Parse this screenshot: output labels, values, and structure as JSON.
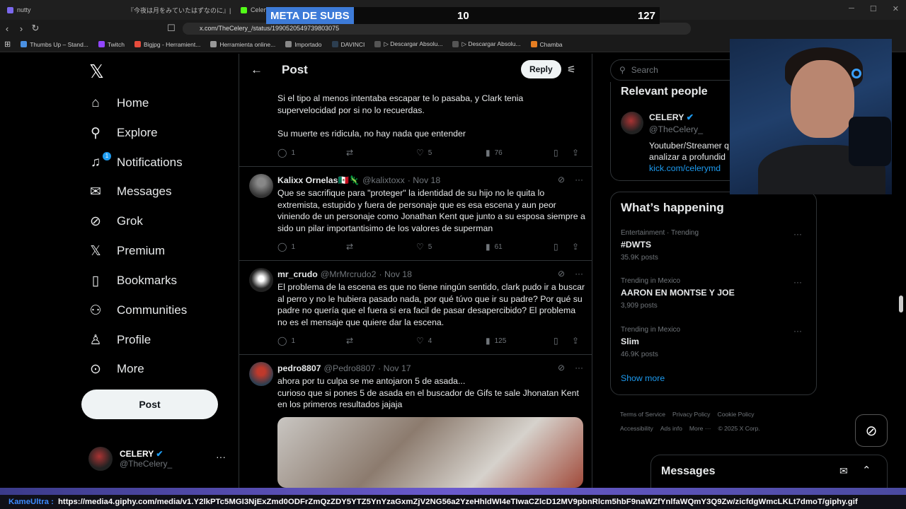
{
  "browser": {
    "tabs": [
      {
        "label": "nutty",
        "color": "#7b68ee"
      },
      {
        "label": "『今夜は月をみていたはずなのに』| 日本",
        "color": "#ff0033"
      },
      {
        "label": "Celery",
        "color": "#53fc18"
      },
      {
        "label": "",
        "color": "#333333"
      }
    ],
    "url": "x.com/TheCelery_/status/1990520549739803075",
    "bookmarks": [
      {
        "label": "Thumbs Up – Stand...",
        "color": "#4a90e2"
      },
      {
        "label": "Twitch",
        "color": "#9146ff"
      },
      {
        "label": "Bigjpg - Herramient...",
        "color": "#e74c3c"
      },
      {
        "label": "Herramienta online...",
        "color": "#999999"
      },
      {
        "label": "Importado",
        "color": "#888888"
      },
      {
        "label": "DAVINCI",
        "color": "#2c3e50"
      },
      {
        "label": "▷ Descargar Absolu...",
        "color": "#555555"
      },
      {
        "label": "▷ Descargar Absolu...",
        "color": "#555555"
      },
      {
        "label": "Chamba",
        "color": "#e67e22"
      }
    ]
  },
  "overlay": {
    "subs_label": "META DE SUBS",
    "subs_current": "10",
    "subs_goal": "127"
  },
  "nav": {
    "items": [
      {
        "label": "Home",
        "icon": "home-icon",
        "glyph": "⌂"
      },
      {
        "label": "Explore",
        "icon": "search-icon",
        "glyph": "⚲"
      },
      {
        "label": "Notifications",
        "icon": "bell-icon",
        "glyph": "🔔",
        "badge": "1"
      },
      {
        "label": "Messages",
        "icon": "envelope-icon",
        "glyph": "✉"
      },
      {
        "label": "Grok",
        "icon": "grok-icon",
        "glyph": "⊘"
      },
      {
        "label": "Premium",
        "icon": "x-premium-icon",
        "glyph": "𝕏"
      },
      {
        "label": "Bookmarks",
        "icon": "bookmark-icon",
        "glyph": "🔖"
      },
      {
        "label": "Communities",
        "icon": "people-icon",
        "glyph": "👥"
      },
      {
        "label": "Profile",
        "icon": "person-icon",
        "glyph": "👤"
      },
      {
        "label": "More",
        "icon": "more-circle-icon",
        "glyph": "⋯"
      }
    ],
    "post_label": "Post",
    "account": {
      "name": "CELERY",
      "handle": "@TheCelery_"
    }
  },
  "main": {
    "title": "Post",
    "reply_label": "Reply",
    "partial_post": {
      "text_lines": [
        "Si el tipo al menos intentaba escapar te lo pasaba, y Clark tenia",
        "supervelocidad por si no lo recuerdas.",
        "",
        "Su muerte es ridicula, no hay nada que entender"
      ],
      "replies": "1",
      "reposts": "",
      "likes": "5",
      "views": "76"
    },
    "tweets": [
      {
        "name": "Kalixx Ornelas🇲🇽🦎",
        "handle": "@kalixtoxx",
        "date": "· Nov 18",
        "text": "Que se sacrifique para \"proteger\" la identidad de su hijo no le quita lo extremista, estupido y fuera de personaje que es esa escena y aun peor viniendo de un personaje como Jonathan Kent que junto a su esposa siempre a sido un pilar importantisimo de los valores de superman",
        "replies": "1",
        "reposts": "",
        "likes": "5",
        "views": "61"
      },
      {
        "name": "mr_crudo",
        "handle": "@MrMrcrudo2",
        "date": "· Nov 18",
        "text": "El problema de la escena es que no tiene ningún sentido, clark pudo ir a buscar al perro y no le hubiera pasado nada, por qué túvo que ir su padre? Por qué su padre no quería que el fuera si era facil de pasar desapercibido? El problema no es el mensaje que quiere dar la escena.",
        "replies": "1",
        "reposts": "",
        "likes": "4",
        "views": "125"
      },
      {
        "name": "pedro8807",
        "handle": "@Pedro8807",
        "date": "· Nov 17",
        "text_lines": [
          "ahora por tu culpa se me antojaron 5 de asada...",
          "curioso que si pones 5 de asada en el buscador de Gifs te sale Jhonatan Kent",
          "en los primeros resultados jajaja"
        ]
      }
    ]
  },
  "right": {
    "search_placeholder": "Search",
    "relevant_title": "Relevant people",
    "person": {
      "name": "CELERY",
      "handle": "@TheCelery_",
      "bio_lines": [
        "Youtuber/Streamer q",
        "analizar a profundid"
      ],
      "link": "kick.com/celerymd"
    },
    "happening_title": "What’s happening",
    "trends": [
      {
        "category": "Entertainment · Trending",
        "title": "#DWTS",
        "count": "35.9K posts"
      },
      {
        "category": "Trending in Mexico",
        "title": "AARON EN MONTSE Y JOE",
        "count": "3,909 posts"
      },
      {
        "category": "Trending in Mexico",
        "title": "Slim",
        "count": "46.9K posts"
      }
    ],
    "show_more": "Show more",
    "footer_links": [
      "Terms of Service",
      "Privacy Policy",
      "Cookie Policy",
      "Accessibility",
      "Ads info",
      "More ···",
      "© 2025 X Corp."
    ]
  },
  "messages_drawer": {
    "title": "Messages"
  },
  "ticker": {
    "user": "KameUltra :",
    "message": "https://media4.giphy.com/media/v1.Y2lkPTc5MGI3NjExZmd0ODFrZmQzZDY5YTZ5YnYzaGxmZjV2NG56a2YzeHhldWI4eTIwaCZlcD12MV9pbnRlcm5hbF9naWZfYnlfaWQmY3Q9Zw/zicfdgWmcLKLt7dmoT/giphy.gif"
  },
  "colors": {
    "accent": "#1d9bf0",
    "background": "#000000",
    "border": "#2f3336",
    "muted": "#71767b",
    "overlay_label": "#3d7bd8",
    "ticker_user": "#3d8bff"
  }
}
